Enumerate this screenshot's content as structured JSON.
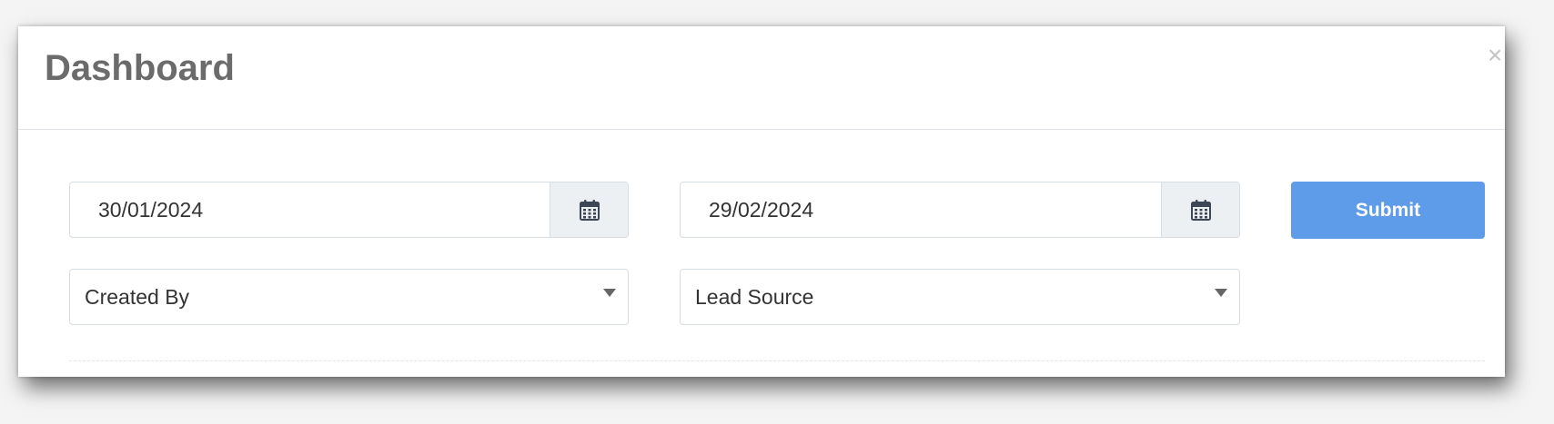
{
  "modal": {
    "title": "Dashboard",
    "close_label": "×"
  },
  "filters": {
    "start_date": {
      "value": "30/01/2024"
    },
    "end_date": {
      "value": "29/02/2024"
    },
    "created_by": {
      "selected": "Created By"
    },
    "lead_source": {
      "selected": "Lead Source"
    },
    "submit_label": "Submit"
  },
  "icons": {
    "date_picker": "calendar-icon",
    "dropdown": "caret-down-icon",
    "close": "close-icon"
  },
  "colors": {
    "accent": "#5e9be9",
    "title": "#6b6b6b",
    "addon_bg": "#edf0f3",
    "border": "#d6dde3"
  }
}
